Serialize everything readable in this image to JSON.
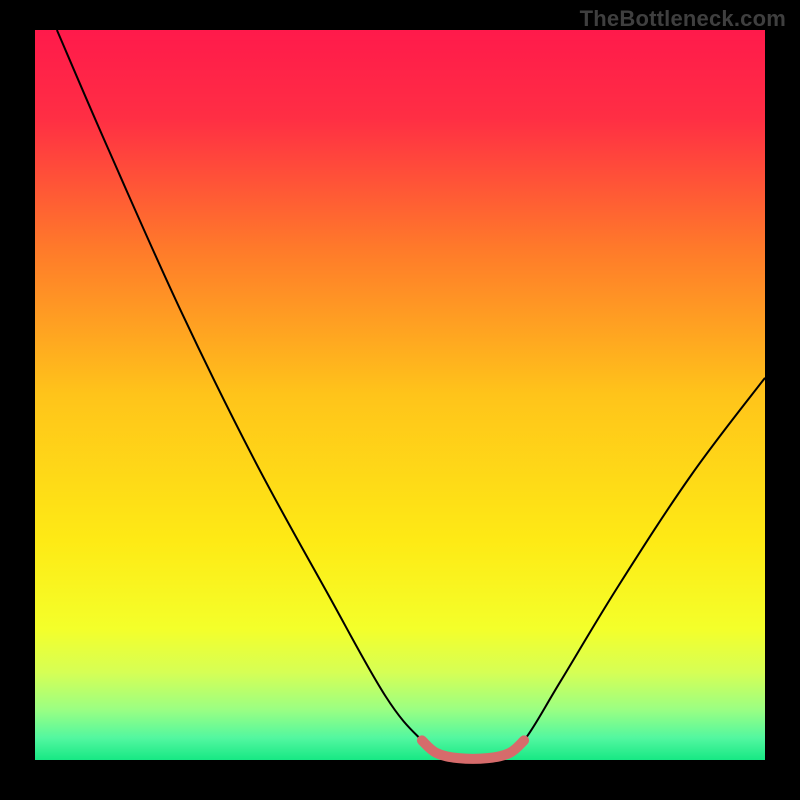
{
  "watermark": "TheBottleneck.com",
  "chart_data": {
    "type": "line",
    "title": "",
    "xlabel": "",
    "ylabel": "",
    "xlim": [
      0,
      100
    ],
    "ylim": [
      0,
      100
    ],
    "grid": false,
    "legend": false,
    "background_gradient": {
      "stops": [
        {
          "pos": 0.0,
          "color": "#ff1a4b"
        },
        {
          "pos": 0.12,
          "color": "#ff2e44"
        },
        {
          "pos": 0.3,
          "color": "#ff7a2a"
        },
        {
          "pos": 0.5,
          "color": "#ffc41a"
        },
        {
          "pos": 0.7,
          "color": "#feea15"
        },
        {
          "pos": 0.82,
          "color": "#f4ff2a"
        },
        {
          "pos": 0.88,
          "color": "#d6ff55"
        },
        {
          "pos": 0.93,
          "color": "#9cff82"
        },
        {
          "pos": 0.97,
          "color": "#52f7a0"
        },
        {
          "pos": 1.0,
          "color": "#17e884"
        }
      ]
    },
    "series": [
      {
        "name": "bottleneck-curve",
        "color": "#000000",
        "stroke_width": 2,
        "points": [
          {
            "x": 3.0,
            "y": 100.0
          },
          {
            "x": 10.0,
            "y": 84.0
          },
          {
            "x": 20.0,
            "y": 62.0
          },
          {
            "x": 30.0,
            "y": 42.0
          },
          {
            "x": 40.0,
            "y": 24.0
          },
          {
            "x": 48.0,
            "y": 10.0
          },
          {
            "x": 53.0,
            "y": 4.0
          },
          {
            "x": 56.0,
            "y": 2.0
          },
          {
            "x": 60.0,
            "y": 1.5
          },
          {
            "x": 64.0,
            "y": 2.0
          },
          {
            "x": 67.0,
            "y": 4.0
          },
          {
            "x": 72.0,
            "y": 12.0
          },
          {
            "x": 80.0,
            "y": 25.0
          },
          {
            "x": 90.0,
            "y": 40.0
          },
          {
            "x": 100.0,
            "y": 53.0
          }
        ]
      },
      {
        "name": "optimal-zone-highlight",
        "color": "#d66b6b",
        "stroke_width": 10,
        "points": [
          {
            "x": 53.0,
            "y": 4.0
          },
          {
            "x": 55.0,
            "y": 2.3
          },
          {
            "x": 58.0,
            "y": 1.6
          },
          {
            "x": 62.0,
            "y": 1.6
          },
          {
            "x": 65.0,
            "y": 2.3
          },
          {
            "x": 67.0,
            "y": 4.0
          }
        ]
      }
    ]
  }
}
